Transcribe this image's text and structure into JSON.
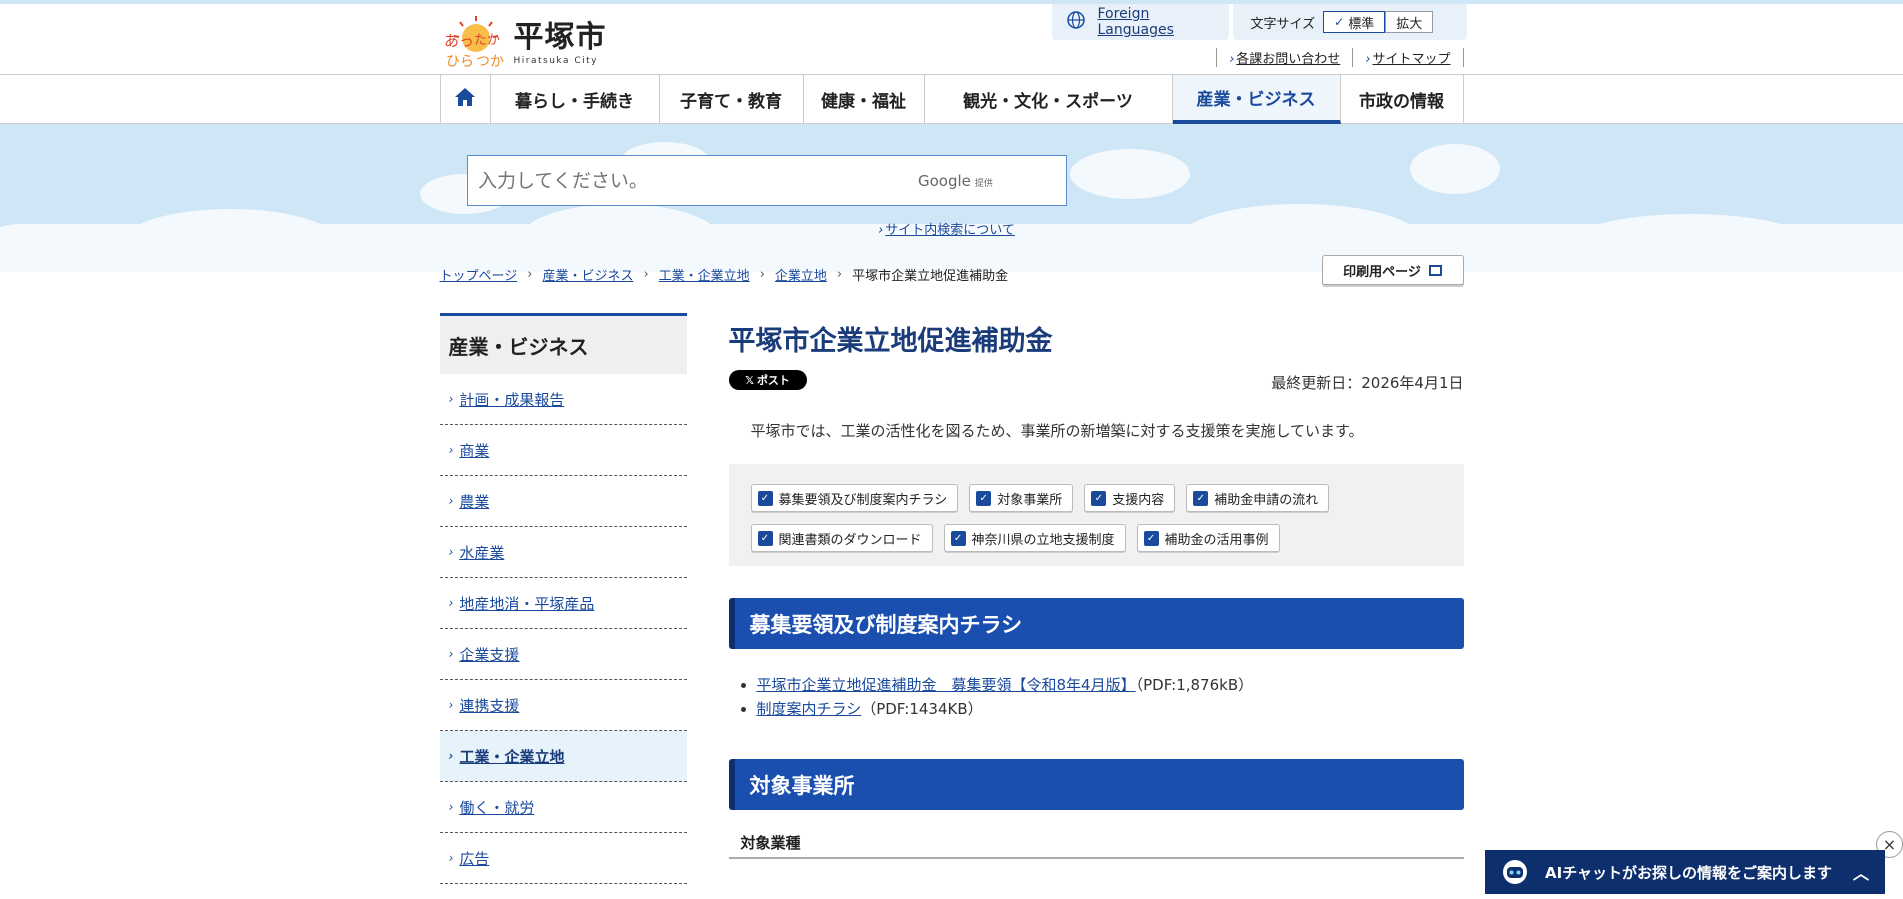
{
  "header": {
    "logo_title": "平塚市",
    "logo_sub": "Hiratsuka City",
    "logo_mark_text": "あったか ひらつか",
    "foreign_languages": "Foreign Languages",
    "font_size_label": "文字サイズ",
    "font_size_options": [
      "標準",
      "拡大"
    ],
    "util_links": [
      "各課お問い合わせ",
      "サイトマップ"
    ]
  },
  "nav": {
    "items": [
      "暮らし・手続き",
      "子育て・教育",
      "健康・福祉",
      "観光・文化・スポーツ",
      "産業・ビジネス",
      "市政の情報"
    ],
    "active": "産業・ビジネス"
  },
  "search": {
    "placeholder": "入力してください。",
    "google_label": "Google",
    "google_provided": "提供",
    "about_link": "サイト内検索について"
  },
  "breadcrumb": [
    "トップページ",
    "産業・ビジネス",
    "工業・企業立地",
    "企業立地",
    "平塚市企業立地促進補助金"
  ],
  "print_button": "印刷用ページ",
  "sidebar": {
    "heading": "産業・ビジネス",
    "items": [
      "計画・成果報告",
      "商業",
      "農業",
      "水産業",
      "地産地消・平塚産品",
      "企業支援",
      "連携支援",
      "工業・企業立地",
      "働く・就労",
      "広告"
    ],
    "active": "工業・企業立地"
  },
  "main": {
    "title": "平塚市企業立地促進補助金",
    "x_post": "ポスト",
    "updated": "最終更新日：2026年4月1日",
    "intro": "平塚市では、工業の活性化を図るため、事業所の新増築に対する支援策を実施しています。",
    "toc": [
      "募集要領及び制度案内チラシ",
      "対象事業所",
      "支援内容",
      "補助金申請の流れ",
      "関連書類のダウンロード",
      "神奈川県の立地支援制度",
      "補助金の活用事例"
    ],
    "section1_title": "募集要領及び制度案内チラシ",
    "docs": [
      {
        "link": "平塚市企業立地促進補助金　募集要領【令和8年4月版】",
        "note": "（PDF:1,876kB）"
      },
      {
        "link": "制度案内チラシ",
        "note": "（PDF:1434KB）"
      }
    ],
    "section2_title": "対象事業所",
    "subhead": "対象業種"
  },
  "ai_chat": {
    "label": "AIチャットがお探しの情報をご案内します",
    "close": "×"
  },
  "colors": {
    "accent": "#1a4a9c",
    "hero_bg": "#cfe6f7",
    "section_bg": "#1a4fb0",
    "chat_bg": "#0e2f6e"
  }
}
